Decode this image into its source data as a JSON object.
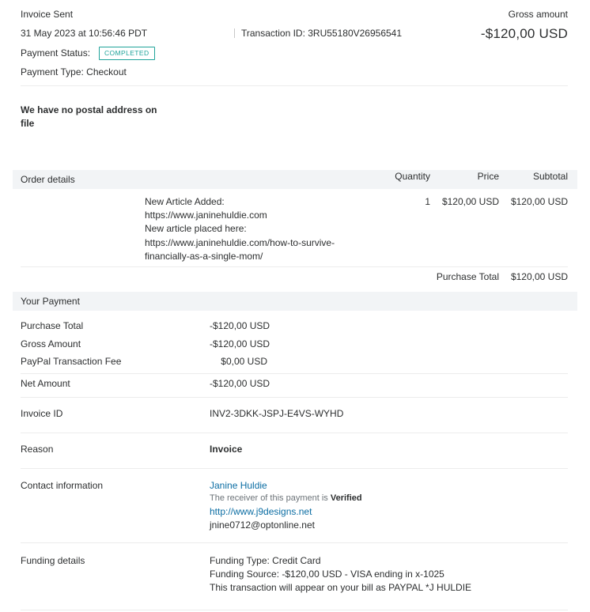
{
  "header": {
    "title": "Invoice Sent",
    "datetime": "31 May 2023 at 10:56:46 PDT",
    "transaction_id": "Transaction ID: 3RU55180V26956541",
    "payment_status_label": "Payment Status:",
    "payment_status_value": "COMPLETED",
    "payment_type": "Payment Type: Checkout",
    "gross_label": "Gross amount",
    "gross_value": "-$120,00 USD"
  },
  "address": {
    "line1": "We have no postal address on",
    "line2": "file"
  },
  "order": {
    "heading": "Order details",
    "col_quantity": "Quantity",
    "col_price": "Price",
    "col_subtotal": "Subtotal",
    "item_lines": [
      "New Article Added:",
      "https://www.janinehuldie.com",
      "New article placed here:",
      "https://www.janinehuldie.com/how-to-survive-",
      "financially-as-a-single-mom/"
    ],
    "item_quantity": "1",
    "item_price": "$120,00 USD",
    "item_subtotal": "$120,00 USD",
    "purchase_total_label": "Purchase Total",
    "purchase_total_value": "$120,00 USD"
  },
  "payment": {
    "heading": "Your Payment",
    "rows": [
      {
        "label": "Purchase Total",
        "value": "-$120,00 USD"
      },
      {
        "label": "Gross Amount",
        "value": "-$120,00 USD"
      },
      {
        "label": "PayPal Transaction Fee",
        "value": "$0,00 USD"
      }
    ],
    "net_label": "Net Amount",
    "net_value": "-$120,00 USD"
  },
  "details": {
    "invoice_label": "Invoice ID",
    "invoice_value": "INV2-3DKK-JSPJ-E4VS-WYHD",
    "reason_label": "Reason",
    "reason_value": "Invoice",
    "contact_label": "Contact information",
    "contact_name": "Janine Huldie",
    "contact_verified_prefix": "The receiver of this payment is",
    "contact_verified_word": "Verified",
    "contact_url": "http://www.j9designs.net",
    "contact_email": "jnine0712@optonline.net",
    "funding_label": "Funding details",
    "funding_type": "Funding Type: Credit Card",
    "funding_source": "Funding Source: -$120,00 USD - VISA ending in x-1025",
    "funding_note": "This transaction will appear on your bill as PAYPAL *J HULDIE"
  },
  "colors": {
    "badge": "#1fa39a",
    "link": "#0b6da3",
    "section_bg": "#f2f4f6"
  }
}
